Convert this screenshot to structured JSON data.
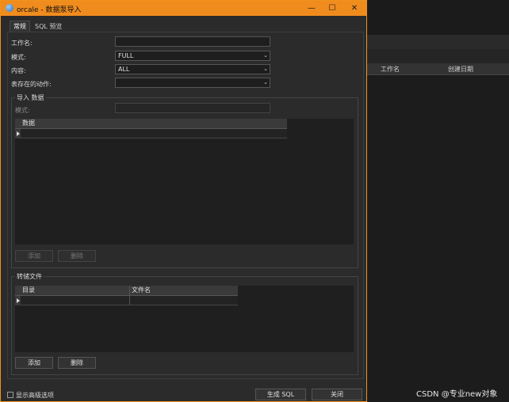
{
  "background": {
    "columns": [
      "工作名",
      "创建日期"
    ],
    "watermark": "CSDN @专业new对象"
  },
  "dialog": {
    "title": "orcale - 数据泵导入",
    "tabs": [
      {
        "label": "常规",
        "active": true
      },
      {
        "label": "SQL 预览",
        "active": false
      }
    ],
    "fields": {
      "job_name_label": "工作名:",
      "job_name_value": "",
      "mode_label": "模式:",
      "mode_value": "FULL",
      "content_label": "内容:",
      "content_value": "ALL",
      "table_exists_label": "表存在的动作:",
      "table_exists_value": ""
    },
    "import_group": {
      "title": "导入 数据",
      "schema_label": "模式:",
      "schema_value": "",
      "grid_header": "数据",
      "add_label": "添加",
      "delete_label": "删除"
    },
    "dump_group": {
      "title": "转储文件",
      "col_dir": "目录",
      "col_file": "文件名",
      "add_label": "添加",
      "delete_label": "删除"
    },
    "footer": {
      "advanced_label": "显示高级选项",
      "generate_sql_label": "生成 SQL",
      "close_label": "关闭"
    }
  },
  "colors": {
    "accent_titlebar": "#f08c1e",
    "dialog_bg": "#2b2b2b"
  }
}
